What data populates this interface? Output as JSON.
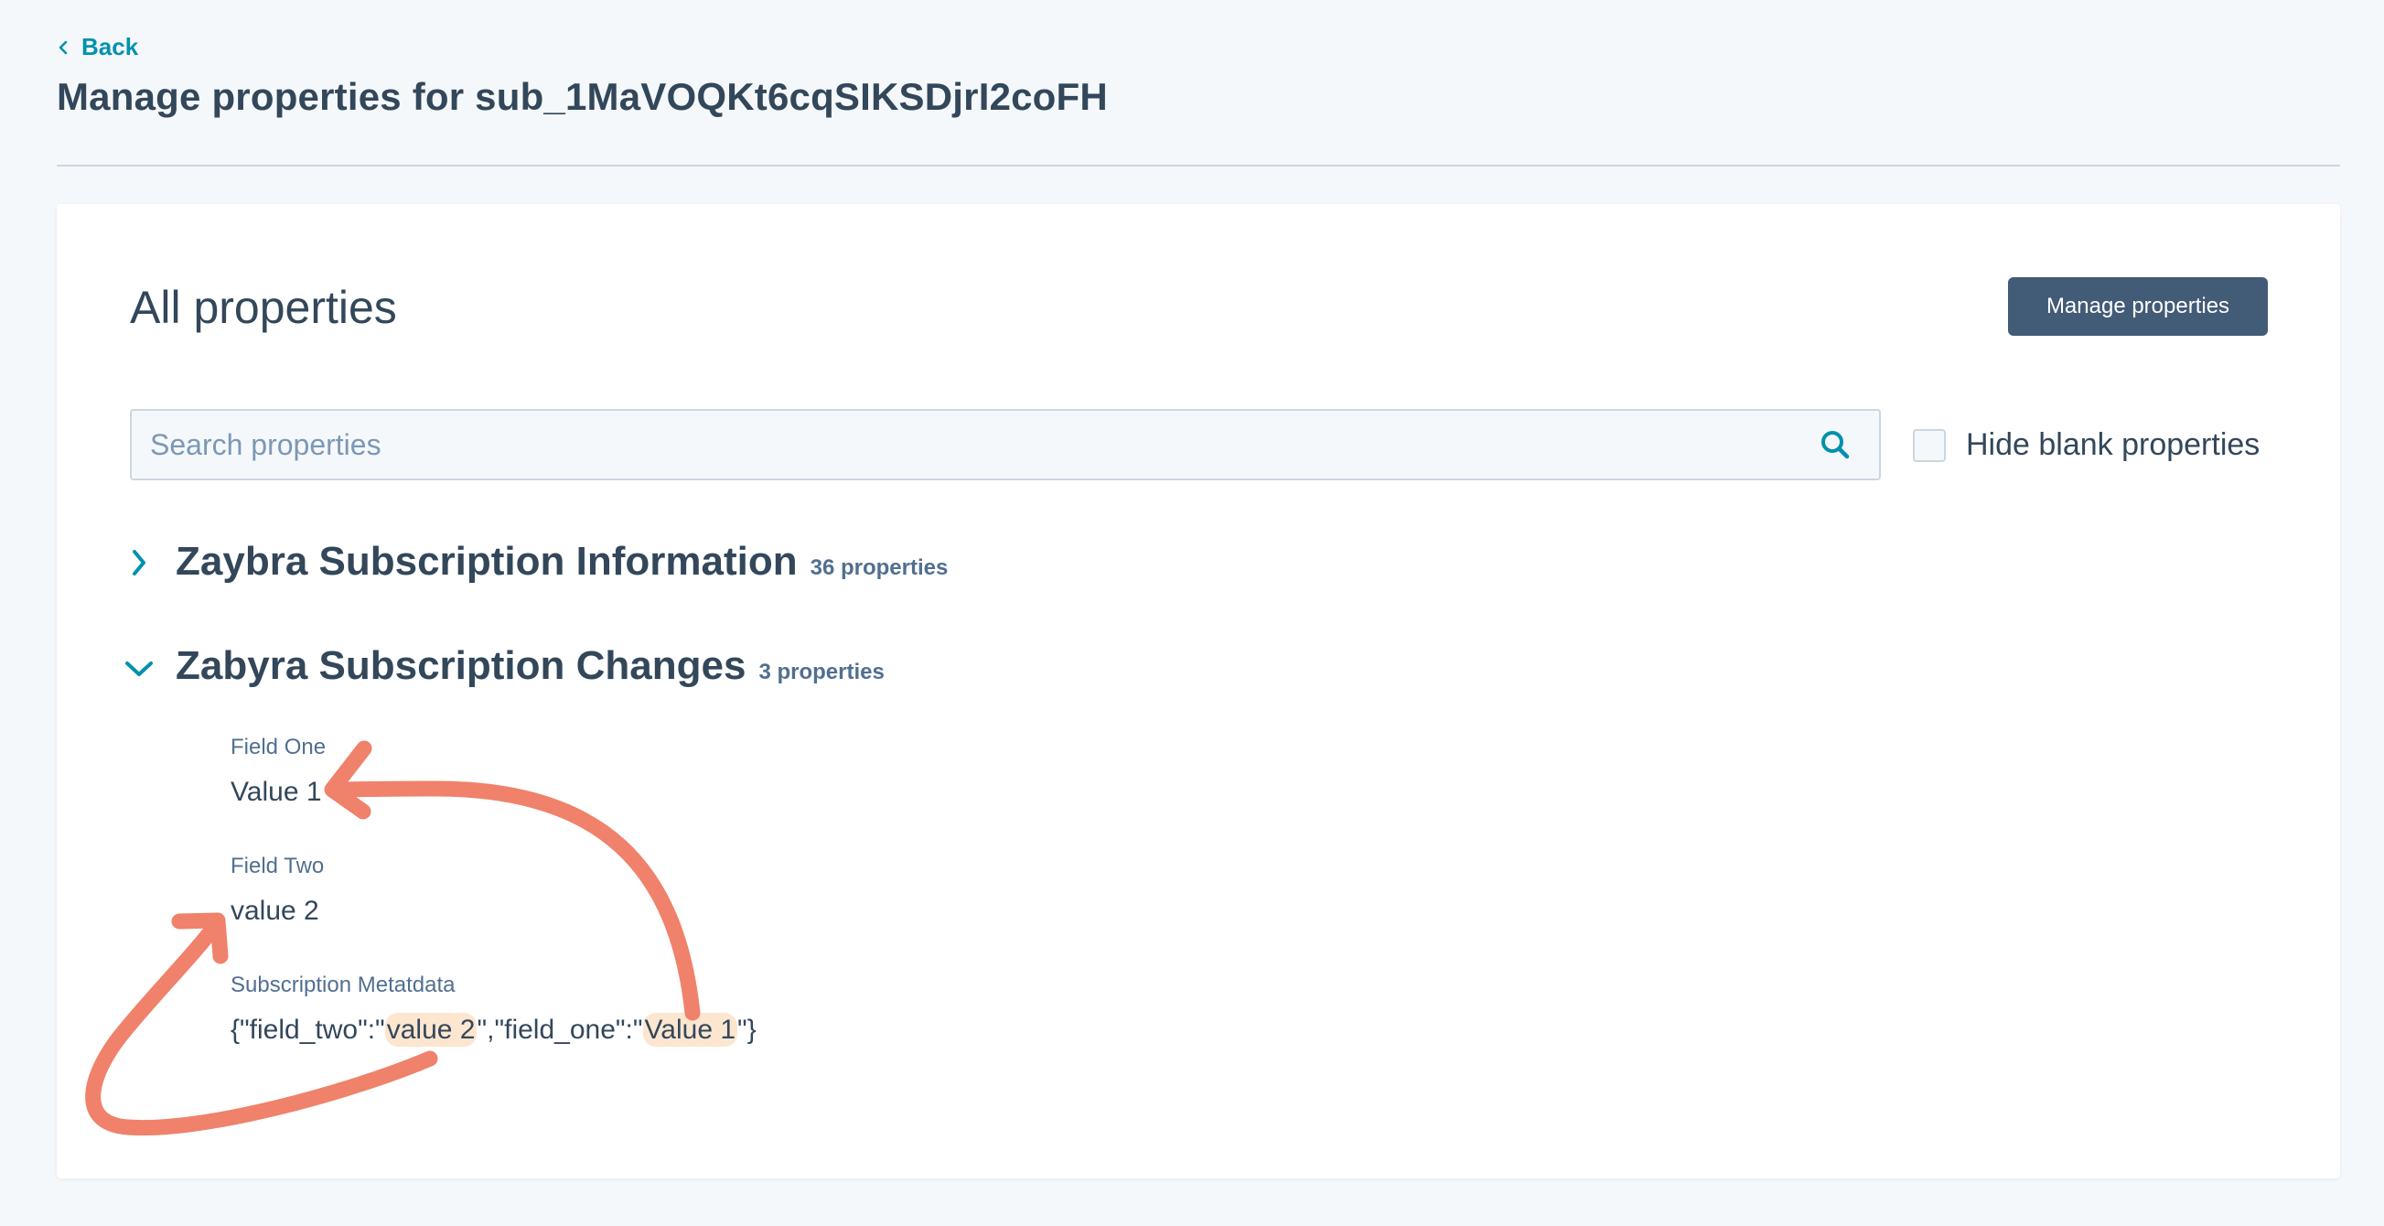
{
  "header": {
    "back_label": "Back",
    "title": "Manage properties for sub_1MaVOQKt6cqSIKSDjrI2coFH"
  },
  "card": {
    "title": "All properties",
    "manage_button_label": "Manage properties",
    "search": {
      "placeholder": "Search properties",
      "value": ""
    },
    "hide_blank": {
      "label": "Hide blank properties",
      "checked": false
    }
  },
  "groups": [
    {
      "name": "Zaybra Subscription Information",
      "count": "36 properties",
      "expanded": false
    },
    {
      "name": "Zabyra Subscription Changes",
      "count": "3 properties",
      "expanded": true,
      "properties": [
        {
          "label": "Field One",
          "value": "Value 1"
        },
        {
          "label": "Field Two",
          "value": "value 2"
        },
        {
          "label": "Subscription Metatdata",
          "value_parts": [
            "{\"field_two\":\"",
            "value 2",
            "\",\"field_one\":\"",
            "Value 1",
            "\"}"
          ]
        }
      ]
    }
  ],
  "colors": {
    "accent": "#0091ae",
    "primary_button": "#425b76",
    "text": "#33475b",
    "annotation_arrow": "#f0816a",
    "highlight": "#fde6cf"
  }
}
